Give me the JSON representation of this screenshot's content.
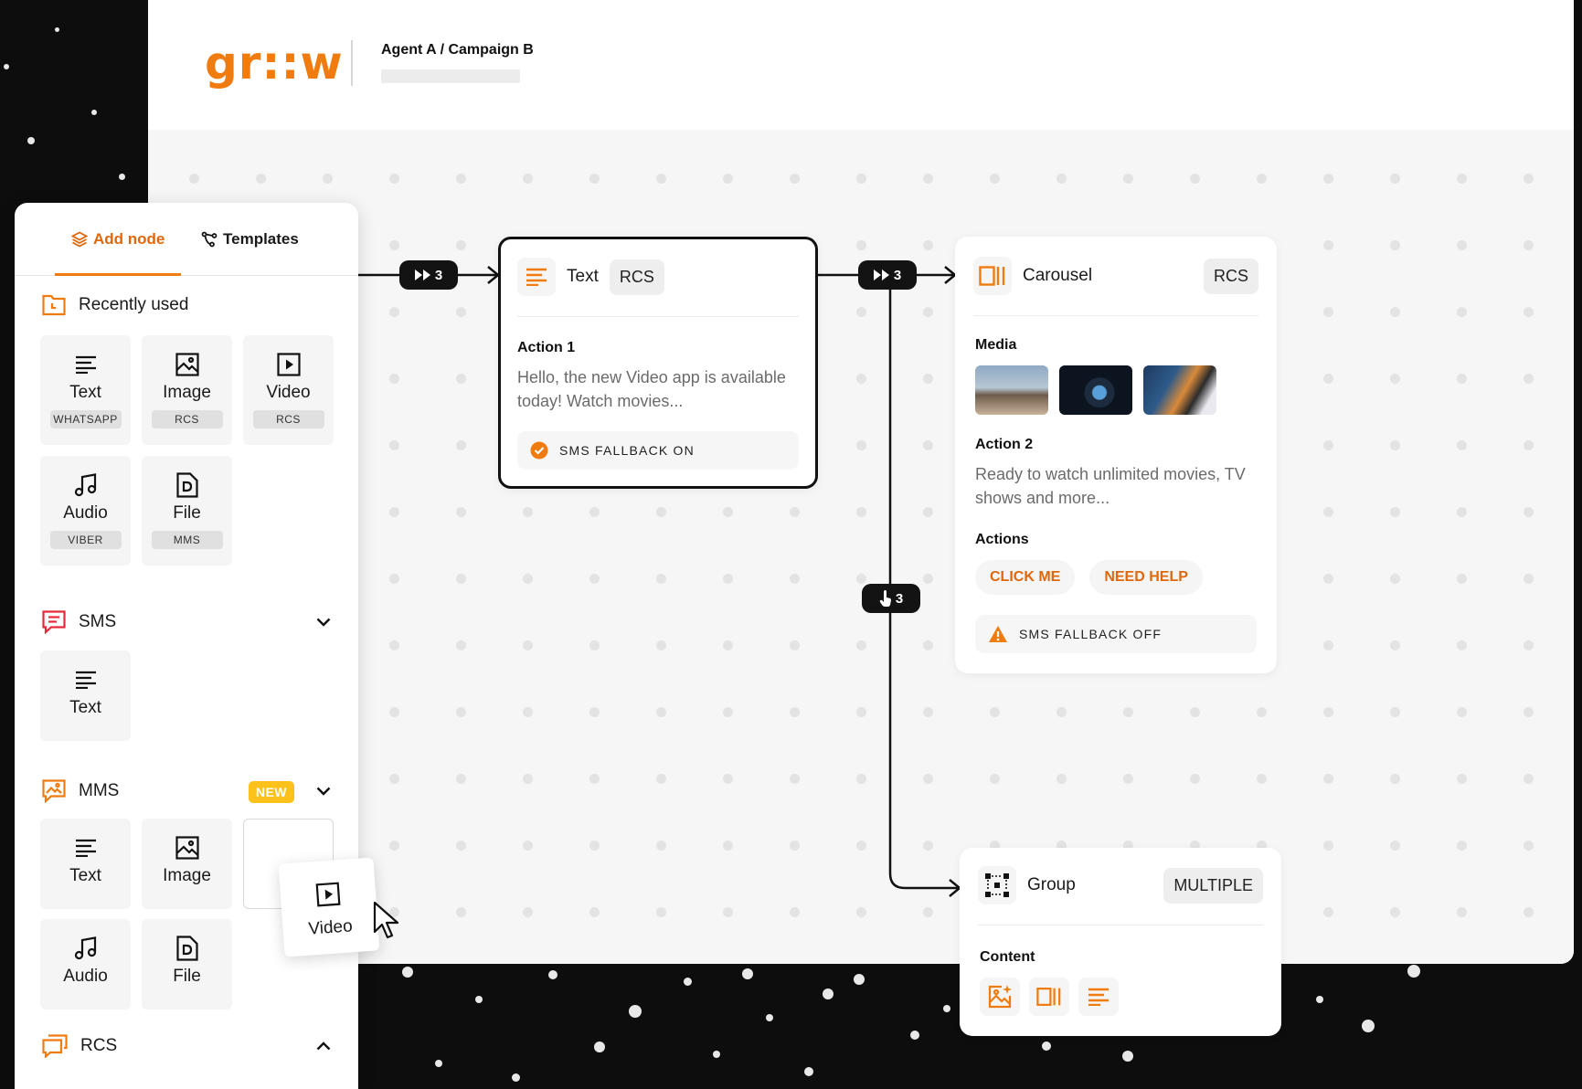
{
  "header": {
    "logo": "gr::w",
    "breadcrumb": "Agent A / Campaign B"
  },
  "connectors": {
    "pill1": "3",
    "pill2": "3",
    "pill3": "3"
  },
  "text_node": {
    "title": "Text",
    "channel": "RCS",
    "action_label": "Action 1",
    "body": "Hello, the new Video app is available today! Watch movies...",
    "fallback": "SMS FALLBACK ON"
  },
  "carousel_node": {
    "title": "Carousel",
    "channel": "RCS",
    "media_label": "Media",
    "action_label": "Action 2",
    "body": "Ready to watch unlimited movies, TV shows and more...",
    "actions_label": "Actions",
    "actions": [
      "CLICK ME",
      "NEED HELP"
    ],
    "fallback": "SMS FALLBACK OFF"
  },
  "group_node": {
    "title": "Group",
    "channel": "MULTIPLE",
    "content_label": "Content"
  },
  "panel": {
    "tabs": {
      "add_node": "Add node",
      "templates": "Templates"
    },
    "recently_used": {
      "label": "Recently used",
      "tiles": [
        {
          "label": "Text",
          "badge": "WHATSAPP",
          "icon": "text-lines-icon"
        },
        {
          "label": "Image",
          "badge": "RCS",
          "icon": "image-icon"
        },
        {
          "label": "Video",
          "badge": "RCS",
          "icon": "video-icon"
        },
        {
          "label": "Audio",
          "badge": "VIBER",
          "icon": "audio-icon"
        },
        {
          "label": "File",
          "badge": "MMS",
          "icon": "file-icon"
        }
      ]
    },
    "sms": {
      "label": "SMS",
      "tiles": [
        {
          "label": "Text"
        }
      ]
    },
    "mms": {
      "label": "MMS",
      "badge": "NEW",
      "tiles": [
        {
          "label": "Text"
        },
        {
          "label": "Image"
        },
        {
          "label": "Audio"
        },
        {
          "label": "File"
        }
      ]
    },
    "rcs": {
      "label": "RCS"
    },
    "dragging": {
      "label": "Video"
    }
  },
  "colors": {
    "accent": "#f07b0f",
    "accent_text": "#e0670a",
    "dark": "#131313",
    "new_badge": "#fcc21b"
  }
}
